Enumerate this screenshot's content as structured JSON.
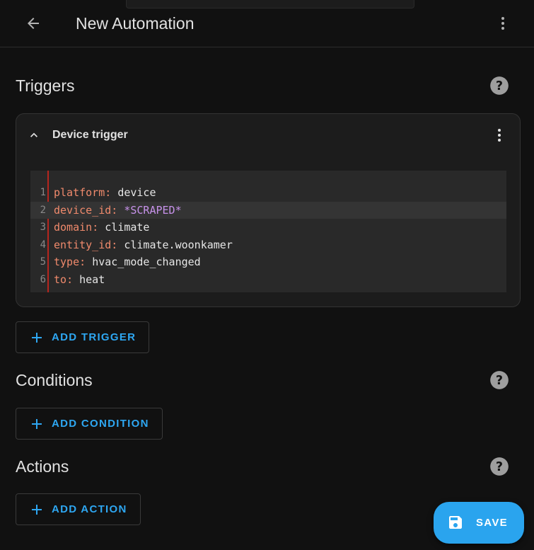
{
  "header": {
    "title": "New Automation",
    "back_icon": "arrow-left-icon",
    "menu_icon": "dots-vertical-icon"
  },
  "triggers": {
    "title": "Triggers",
    "help_icon": "help-circle-icon",
    "card": {
      "title": "Device trigger",
      "collapse_icon": "chevron-up-icon",
      "menu_icon": "dots-vertical-icon",
      "code_lines": [
        {
          "num": "1",
          "key": "platform",
          "sep": ": ",
          "value": "device",
          "special": false
        },
        {
          "num": "2",
          "key": "device_id",
          "sep": ": ",
          "value": "*SCRAPED*",
          "special": true
        },
        {
          "num": "3",
          "key": "domain",
          "sep": ": ",
          "value": "climate",
          "special": false
        },
        {
          "num": "4",
          "key": "entity_id",
          "sep": ": ",
          "value": "climate.woonkamer",
          "special": false
        },
        {
          "num": "5",
          "key": "type",
          "sep": ": ",
          "value": "hvac_mode_changed",
          "special": false
        },
        {
          "num": "6",
          "key": "to",
          "sep": ": ",
          "value": "heat",
          "special": false
        }
      ]
    },
    "add_label": "ADD TRIGGER"
  },
  "conditions": {
    "title": "Conditions",
    "help_icon": "help-circle-icon",
    "add_label": "ADD CONDITION"
  },
  "actions": {
    "title": "Actions",
    "help_icon": "help-circle-icon",
    "add_label": "ADD ACTION"
  },
  "save": {
    "label": "SAVE",
    "icon": "content-save-icon"
  },
  "colors": {
    "background": "#111111",
    "card": "#1c1c1c",
    "accent": "#2aa4ee",
    "yaml_key": "#f08a6c",
    "yaml_special": "#c792ea",
    "gutter_marker": "#b5261e"
  }
}
